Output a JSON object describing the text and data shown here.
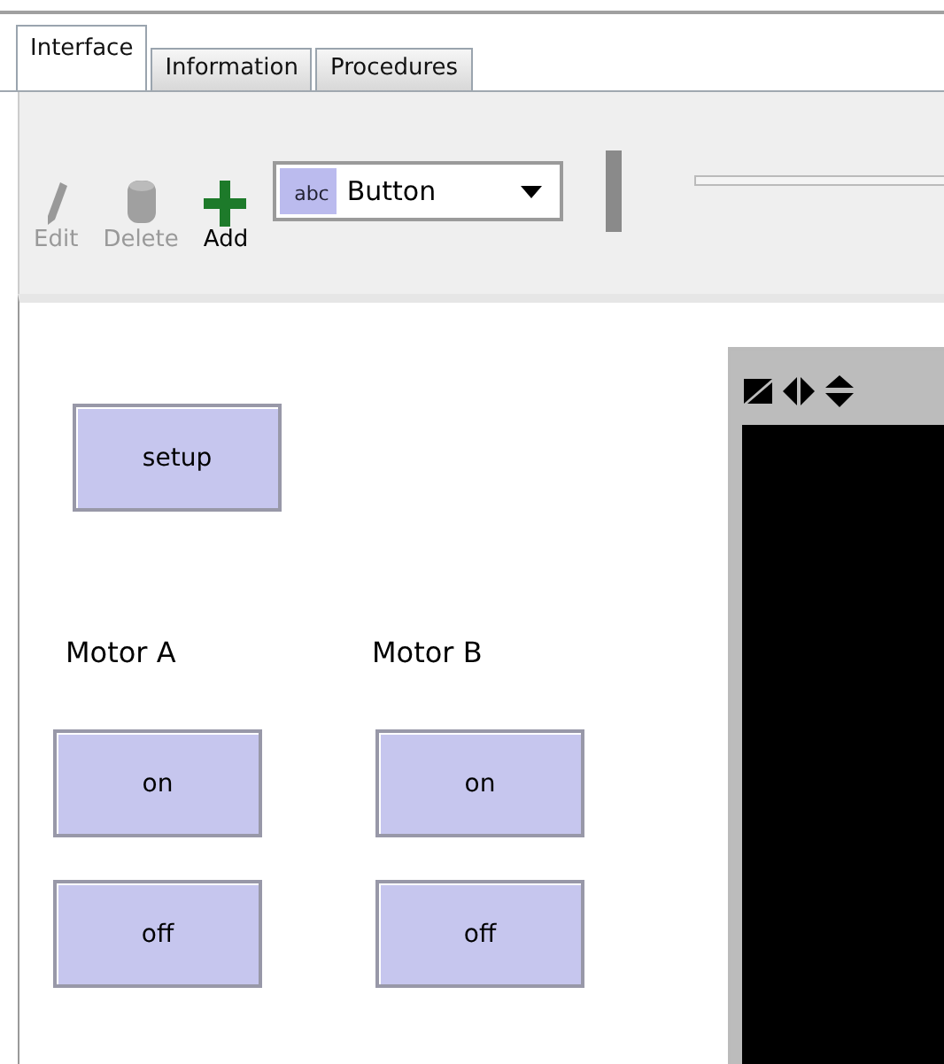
{
  "tabs": [
    {
      "label": "Interface",
      "selected": true
    },
    {
      "label": "Information",
      "selected": false
    },
    {
      "label": "Procedures",
      "selected": false
    }
  ],
  "toolbar": {
    "tools": [
      {
        "kind": "edit",
        "label": "Edit",
        "disabled": true
      },
      {
        "kind": "delete",
        "label": "Delete",
        "disabled": true
      },
      {
        "kind": "add",
        "label": "Add",
        "disabled": false
      }
    ],
    "widget_type": {
      "icon_text": "abc",
      "value": "Button"
    }
  },
  "widgets": [
    {
      "kind": "button",
      "label": "setup"
    },
    {
      "kind": "label",
      "label": "Motor A"
    },
    {
      "kind": "label",
      "label": "Motor B"
    },
    {
      "kind": "button",
      "label": "on"
    },
    {
      "kind": "button",
      "label": "on"
    },
    {
      "kind": "button",
      "label": "off"
    },
    {
      "kind": "button",
      "label": "off"
    }
  ]
}
